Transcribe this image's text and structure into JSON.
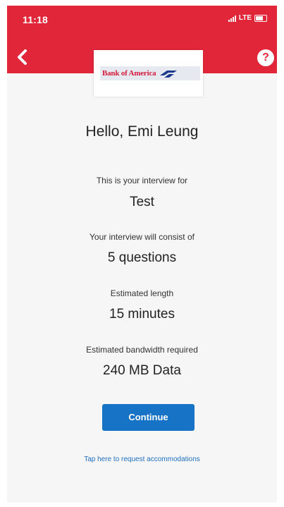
{
  "status_bar": {
    "time": "11:18",
    "carrier": "LTE"
  },
  "header": {
    "brand_color": "#e2263a",
    "logo_text": "Bank of America",
    "back_icon": "chevron-left-icon",
    "help_icon": "question-mark-icon",
    "help_glyph": "?"
  },
  "main": {
    "greeting": "Hello, Emi Leung",
    "interview_label": "This is your interview for",
    "interview_value": "Test",
    "consist_label": "Your interview will consist of",
    "consist_value": "5 questions",
    "length_label": "Estimated length",
    "length_value": "15 minutes",
    "bandwidth_label": "Estimated bandwidth required",
    "bandwidth_value": "240 MB Data",
    "continue_label": "Continue",
    "accommodations_link": "Tap here to request accommodations"
  },
  "colors": {
    "button": "#1673c6",
    "link": "#1f6fbf",
    "background": "#f6f6f6"
  }
}
